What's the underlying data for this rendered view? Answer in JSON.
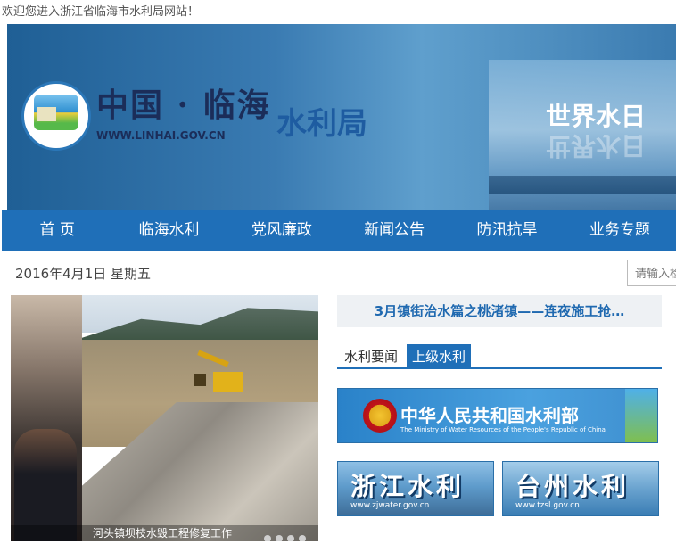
{
  "top": {
    "welcome": "欢迎您进入浙江省临海市水利局网站！"
  },
  "banner": {
    "brand_name": "中国 · 临海",
    "url": "WWW.LINHAI.GOV.CN",
    "department": "水利局",
    "event": "世界水日"
  },
  "nav": {
    "items": [
      "首 页",
      "临海水利",
      "党风廉政",
      "新闻公告",
      "防汛抗旱",
      "业务专题"
    ]
  },
  "date": "2016年4月1日 星期五",
  "search": {
    "placeholder": "请输入检"
  },
  "photo": {
    "caption": "河头镇坝枝水毁工程修复工作"
  },
  "headline": "3月镇街治水篇之桃渚镇——连夜施工抢…",
  "tabs": [
    "水利要闻",
    "上级水利"
  ],
  "links": {
    "mwr_title": "中华人民共和国水利部",
    "mwr_subtitle": "The Ministry of Water Resources of the People's Republic of China",
    "zj_title": "浙江水利",
    "zj_url": "www.zjwater.gov.cn",
    "tz_title": "台州水利",
    "tz_url": "www.tzsl.gov.cn"
  }
}
